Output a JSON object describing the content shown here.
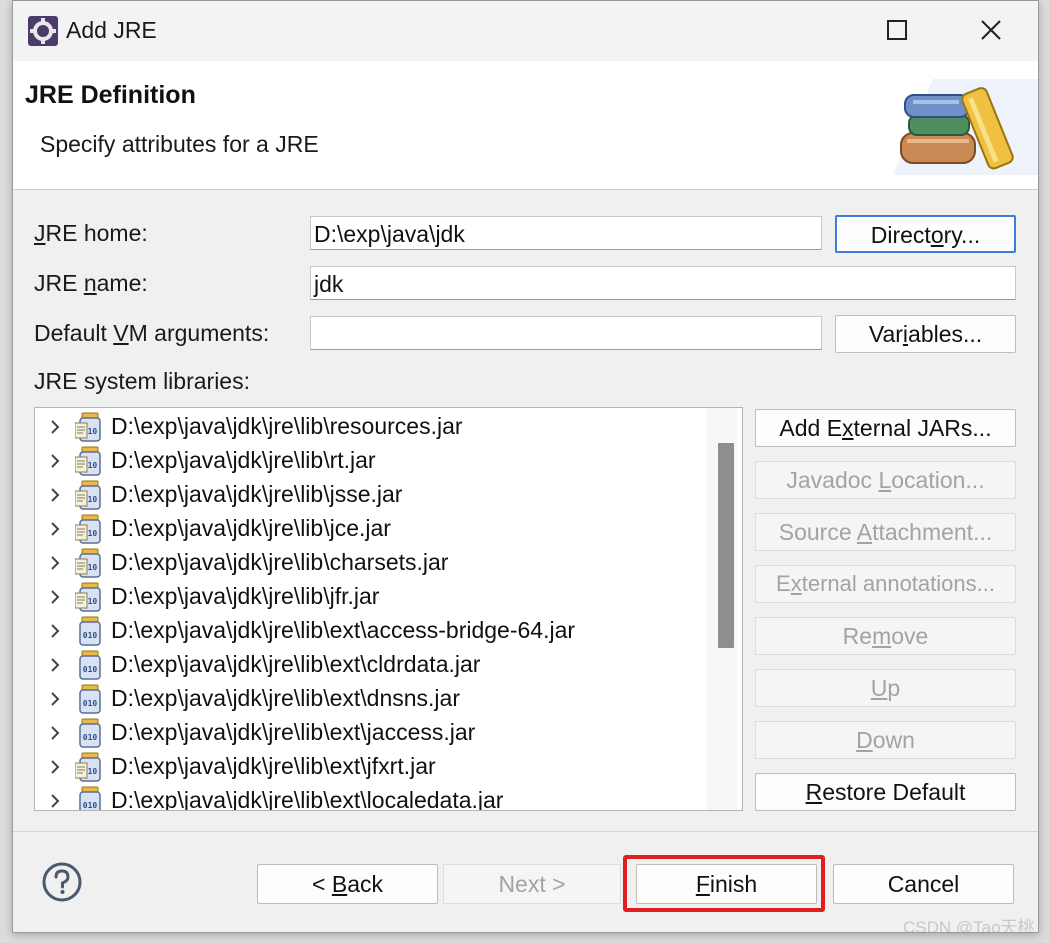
{
  "window": {
    "title": "Add JRE",
    "maximize_icon": "maximize-icon",
    "close_icon": "close-icon"
  },
  "banner": {
    "title": "JRE Definition",
    "description": "Specify attributes for a JRE",
    "art_icon": "library-books-icon"
  },
  "form": {
    "jre_home": {
      "label_prefix": "J",
      "label_rest": "RE home:",
      "value": "D:\\exp\\java\\jdk"
    },
    "jre_name": {
      "label_a": "JRE ",
      "label_u": "n",
      "label_b": "ame:",
      "value": "jdk"
    },
    "vm_args": {
      "label_a": "Default ",
      "label_u": "V",
      "label_b": "M arguments:",
      "value": ""
    },
    "directory_button": {
      "a": "Direct",
      "u": "o",
      "b": "ry..."
    },
    "variables_button": {
      "a": "Var",
      "u": "i",
      "b": "ables..."
    },
    "libraries_label": "JRE system libraries:"
  },
  "libraries": [
    {
      "path": "D:\\exp\\java\\jdk\\jre\\lib\\resources.jar",
      "icon": "jar-source-icon"
    },
    {
      "path": "D:\\exp\\java\\jdk\\jre\\lib\\rt.jar",
      "icon": "jar-source-icon"
    },
    {
      "path": "D:\\exp\\java\\jdk\\jre\\lib\\jsse.jar",
      "icon": "jar-source-icon"
    },
    {
      "path": "D:\\exp\\java\\jdk\\jre\\lib\\jce.jar",
      "icon": "jar-source-icon"
    },
    {
      "path": "D:\\exp\\java\\jdk\\jre\\lib\\charsets.jar",
      "icon": "jar-source-icon"
    },
    {
      "path": "D:\\exp\\java\\jdk\\jre\\lib\\jfr.jar",
      "icon": "jar-source-icon"
    },
    {
      "path": "D:\\exp\\java\\jdk\\jre\\lib\\ext\\access-bridge-64.jar",
      "icon": "jar-binary-icon"
    },
    {
      "path": "D:\\exp\\java\\jdk\\jre\\lib\\ext\\cldrdata.jar",
      "icon": "jar-binary-icon"
    },
    {
      "path": "D:\\exp\\java\\jdk\\jre\\lib\\ext\\dnsns.jar",
      "icon": "jar-binary-icon"
    },
    {
      "path": "D:\\exp\\java\\jdk\\jre\\lib\\ext\\jaccess.jar",
      "icon": "jar-binary-icon"
    },
    {
      "path": "D:\\exp\\java\\jdk\\jre\\lib\\ext\\jfxrt.jar",
      "icon": "jar-source-icon"
    },
    {
      "path": "D:\\exp\\java\\jdk\\jre\\lib\\ext\\localedata.jar",
      "icon": "jar-binary-icon"
    }
  ],
  "side_buttons": {
    "add_external": {
      "a": "Add E",
      "u": "x",
      "b": "ternal JARs..."
    },
    "javadoc": {
      "a": "Javadoc ",
      "u": "L",
      "b": "ocation..."
    },
    "source": {
      "a": "Source ",
      "u": "A",
      "b": "ttachment..."
    },
    "annotations": {
      "a": "E",
      "u": "x",
      "b": "ternal annotations..."
    },
    "remove": {
      "a": "Re",
      "u": "m",
      "b": "ove"
    },
    "up": {
      "a": "",
      "u": "U",
      "b": "p"
    },
    "down": {
      "a": "",
      "u": "D",
      "b": "own"
    },
    "restore": {
      "a": "",
      "u": "R",
      "b": "estore Default"
    }
  },
  "footer": {
    "help_icon": "help-icon",
    "back": {
      "a": "< ",
      "u": "B",
      "b": "ack"
    },
    "next": {
      "a": "Next >",
      "u": "",
      "b": ""
    },
    "finish": {
      "a": "",
      "u": "F",
      "b": "inish"
    },
    "cancel": "Cancel"
  },
  "watermark": "CSDN @Tao天桃"
}
